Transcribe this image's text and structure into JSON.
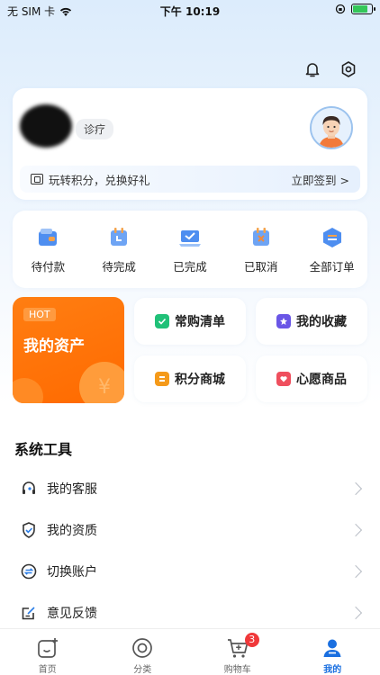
{
  "status": {
    "carrier": "无 SIM 卡",
    "time": "下午 10:19"
  },
  "header": {
    "icons": [
      "bell-icon",
      "settings-icon"
    ]
  },
  "profile": {
    "tag": "诊疗",
    "sign_text": "玩转积分，兑换好礼",
    "sign_link": "立即签到 >"
  },
  "orders": [
    {
      "label": "待付款",
      "icon": "wallet-icon"
    },
    {
      "label": "待完成",
      "icon": "calendar-icon"
    },
    {
      "label": "已完成",
      "icon": "laptop-icon"
    },
    {
      "label": "已取消",
      "icon": "cancel-box-icon"
    },
    {
      "label": "全部订单",
      "icon": "stack-icon"
    }
  ],
  "asset": {
    "hot": "HOT",
    "title": "我的资产",
    "coin": "¥"
  },
  "quick": [
    {
      "label": "常购清单",
      "icon": "checklist-icon",
      "color": "#20c178"
    },
    {
      "label": "我的收藏",
      "icon": "star-icon",
      "color": "#6a56e6"
    },
    {
      "label": "积分商城",
      "icon": "coin-icon",
      "color": "#f59a1a"
    },
    {
      "label": "心愿商品",
      "icon": "wish-bag-icon",
      "color": "#ef4f5e"
    }
  ],
  "tools": {
    "title": "系统工具",
    "items": [
      {
        "label": "我的客服",
        "icon": "headset-icon"
      },
      {
        "label": "我的资质",
        "icon": "shield-check-icon"
      },
      {
        "label": "切换账户",
        "icon": "switch-icon"
      },
      {
        "label": "意见反馈",
        "icon": "feedback-icon"
      }
    ]
  },
  "tabbar": [
    {
      "label": "首页",
      "icon": "home-icon"
    },
    {
      "label": "分类",
      "icon": "category-icon"
    },
    {
      "label": "购物车",
      "icon": "cart-icon",
      "badge": "3"
    },
    {
      "label": "我的",
      "icon": "user-icon"
    }
  ],
  "colors": {
    "accent": "#1a6fe0",
    "orange": "#ff6a00",
    "badge": "#f0383a"
  }
}
